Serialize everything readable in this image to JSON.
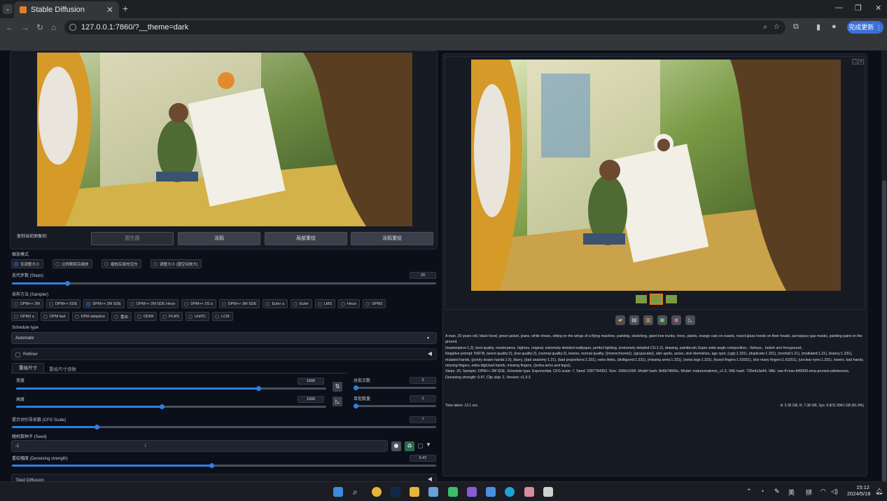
{
  "browser": {
    "tab_title": "Stable Diffusion",
    "url": "127.0.0.1:7860/?__theme=dark",
    "update_button": "完成更新"
  },
  "left": {
    "copy_label": "复制当前图像到:",
    "copy_targets": [
      "图生图",
      "涂鸦",
      "局部重绘",
      "涂鸦重绘"
    ],
    "resize_mode_label": "缩放模式",
    "resize_modes": [
      "仅调整大小",
      "比例裁剪后缩放",
      "缩放后填充空白",
      "调整大小 (潜空间放大)"
    ],
    "resize_mode_selected": 0,
    "steps_label": "迭代步数 (Steps)",
    "steps_value": "20",
    "steps_fraction": 0.13,
    "sampler_label": "采样方法 (Sampler)",
    "samplers_row1": [
      "DPM++ 2M",
      "DPM++ SDE",
      "DPM++ 2M SDE",
      "DPM++ 2M SDE Heun",
      "DPM++ 2S a",
      "DPM++ 3M SDE",
      "Euler a",
      "Euler",
      "LMS",
      "Heun",
      "DPM2"
    ],
    "samplers_row2": [
      "DPM2 a",
      "DPM fast",
      "DPM adaptive",
      "重启",
      "DDIM",
      "PLMS",
      "UniPC",
      "LCM"
    ],
    "sampler_selected": "DPM++ 2M SDE",
    "schedule_label": "Schedule type",
    "schedule_value": "Automatic",
    "refiner_label": "Refiner",
    "size_tabs": [
      "重绘尺寸",
      "重绘尺寸倍数"
    ],
    "width_label": "宽度",
    "width_value": "1600",
    "width_fraction": 0.78,
    "height_label": "高度",
    "height_value": "1000",
    "height_fraction": 0.47,
    "batch_count_label": "总批次数",
    "batch_count_value": "2",
    "batch_size_label": "单批数量",
    "batch_size_value": "1",
    "cfg_label": "提示词引导系数 (CFG Scale)",
    "cfg_value": "7",
    "cfg_fraction": 0.2,
    "seed_label": "随机数种子 (Seed)",
    "seed_value": "-1",
    "denoise_label": "重绘幅度 (Denoising strength)",
    "denoise_value": "0.47",
    "denoise_fraction": 0.47,
    "tiled_label": "Tiled Diffusion"
  },
  "right": {
    "prompt": "A man, 20 years old, black hood, green jacket, jeans, white shoes, sitting on the wings of a flying machine, painting, sketching, giant tree trunks, trees, plants, orange cats on easels, round glass hoods on their heads, aerospace gas masks, painting paint on the ground,",
    "prompt2": "(masterpiece:1,2), best quality, masterpiece, highres, original, extremely detailed wallpaper, perfect lighting, (extremely detailed CG:1.2), drawing, paintbrush,Super wide-angle composition，fisheye，bokeh arm foreground，",
    "negative": "Negative prompt: NSFW, (worst quality:2), (low quality:2), (normal quality:2), lowres, normal quality, ((monochrome)), ((grayscale)), skin spots, acnes, skin blemishes, age spot, (ugly:1.331), (duplicate:1.331), (morbid:1.21), (mutilated:1.21), (tranny:1.331), mutated hands, (poorly drawn hands:1.5), blurry, (bad anatomy:1.21), (bad proportions:1.331), extra limbs, (disfigured:1.331), (missing arms:1.331), (extra legs:1.331), (fused fingers:1.61051), (too many fingers:1.61051), (unclear eyes:1.331), lowers, bad hands, missing fingers, extra digit,bad hands, missing fingers, ((extra arms and legs)),",
    "params": "Steps: 20, Sampler: DPM++ 2M SDE, Schedule type: Exponential, CFG scale: 7, Seed: 2287794352, Size: 1600x1000, Model hash: 8e6b79666c, Model: maturemalemix_v1.3, VAE hash: 735e4c3a44, VAE: vae-ft-mse-840000-ema-pruned.safetensors, Denoising strength: 0.47, Clip skip: 2, Version: v1.9.3",
    "time_taken": "Time taken: 13.1 sec.",
    "memory": "A: 5.35 GB, R: 7.38 GB, Sys: 9.8/11.9941 GB (81.4%)"
  },
  "taskbar": {
    "time": "15:12",
    "date": "2024/5/18",
    "ime1": "英",
    "ime2": "拼"
  },
  "colors": {
    "accent": "#2f7fe0",
    "orange_selected": "#e07a1f",
    "bg": "#0b0f19"
  }
}
